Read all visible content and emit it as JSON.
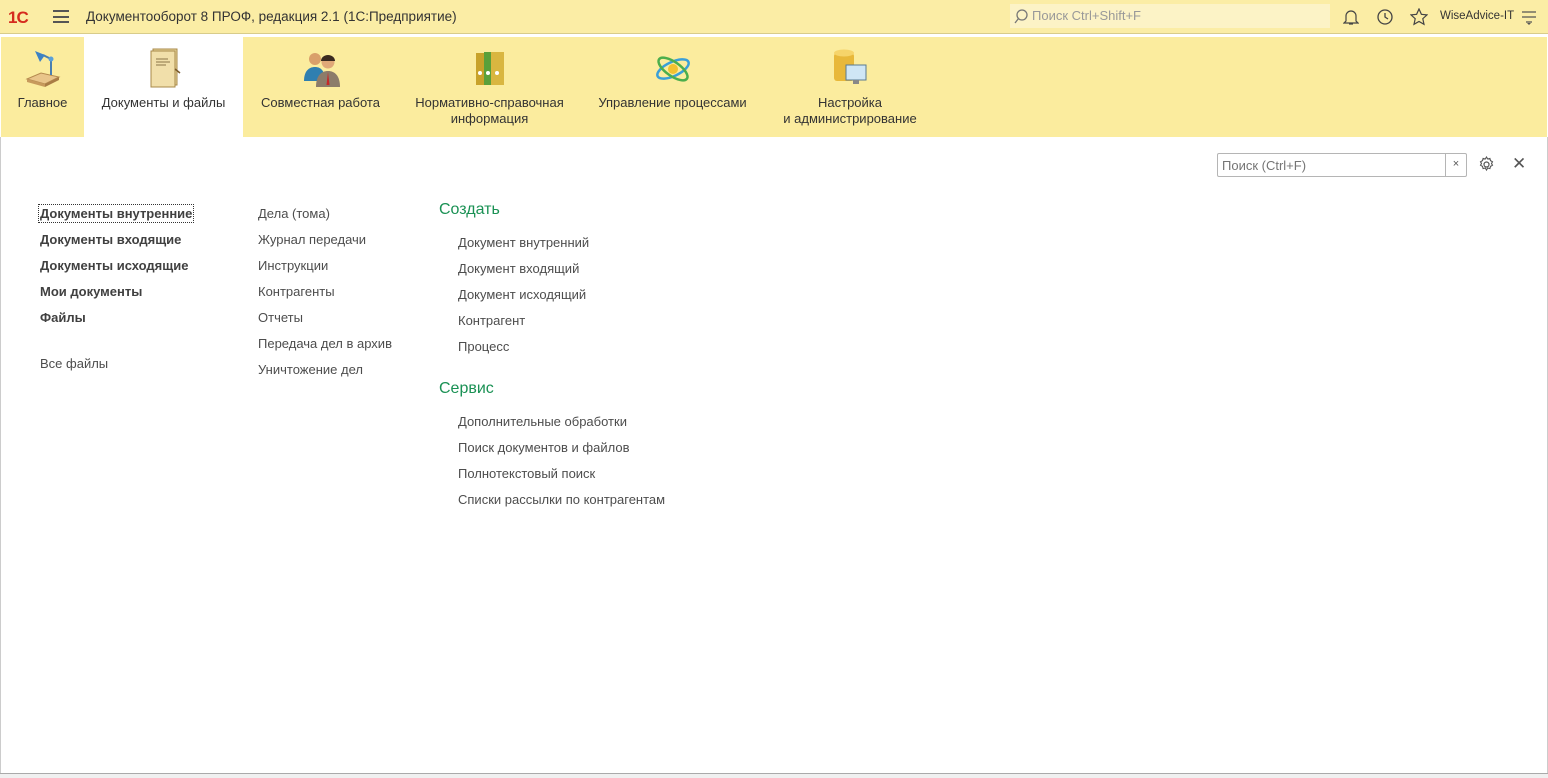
{
  "titlebar": {
    "logo": "1С",
    "title": "Документооборот 8 ПРОФ, редакция 2.1  (1С:Предприятие)",
    "search_placeholder": "Поиск Ctrl+Shift+F",
    "user": "WiseAdvice-IT"
  },
  "sections": [
    {
      "label": "Главное",
      "icon": "desk-lamp-icon"
    },
    {
      "label": "Документы и файлы",
      "icon": "folder-documents-icon",
      "active": true
    },
    {
      "label": "Совместная работа",
      "icon": "people-icon"
    },
    {
      "label": "Нормативно-справочная\nинформация",
      "icon": "binders-icon"
    },
    {
      "label": "Управление процессами",
      "icon": "process-atom-icon"
    },
    {
      "label": "Настройка\nи администрирование",
      "icon": "admin-database-icon"
    }
  ],
  "panel": {
    "search_placeholder": "Поиск (Ctrl+F)",
    "clear": "×",
    "close": "✕"
  },
  "col1_bold": [
    "Документы внутренние",
    "Документы входящие",
    "Документы исходящие",
    "Мои документы",
    "Файлы"
  ],
  "col1_extra": [
    "Все файлы"
  ],
  "col2": [
    "Дела (тома)",
    "Журнал передачи",
    "Инструкции",
    "Контрагенты",
    "Отчеты",
    "Передача дел в архив",
    "Уничтожение дел"
  ],
  "create": {
    "title": "Создать",
    "items": [
      "Документ внутренний",
      "Документ входящий",
      "Документ исходящий",
      "Контрагент",
      "Процесс"
    ]
  },
  "service": {
    "title": "Сервис",
    "items": [
      "Дополнительные обработки",
      "Поиск документов и файлов",
      "Полнотекстовый поиск",
      "Списки рассылки по контрагентам"
    ]
  }
}
